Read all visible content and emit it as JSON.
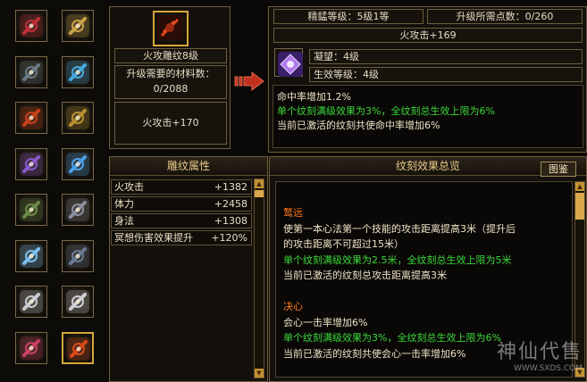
{
  "equipment": {
    "slots": [
      {
        "icon": "red-crystal-icon",
        "color": "#c0303a"
      },
      {
        "icon": "gold-ring-icon",
        "color": "#c8a24a"
      },
      {
        "icon": "armor-icon",
        "color": "#6a7a84"
      },
      {
        "icon": "blue-gem-ring-icon",
        "color": "#4aa8e0"
      },
      {
        "icon": "red-bracer-icon",
        "color": "#c8401a"
      },
      {
        "icon": "gold-bracer-icon",
        "color": "#b89030"
      },
      {
        "icon": "necklace-icon",
        "color": "#8a5ac8"
      },
      {
        "icon": "sword-icon",
        "color": "#4aa0e8"
      },
      {
        "icon": "belt-icon",
        "color": "#6a8a48"
      },
      {
        "icon": "gauntlet-icon",
        "color": "#8a90a0"
      },
      {
        "icon": "ice-blade-icon",
        "color": "#7ac0f0"
      },
      {
        "icon": "boots-icon",
        "color": "#6a7a94"
      },
      {
        "icon": "jade-pendant-icon",
        "color": "#c8ccd0"
      },
      {
        "icon": "jade-pendant-icon",
        "color": "#d0d0d4"
      },
      {
        "icon": "amulet-icon",
        "color": "#c84060"
      },
      {
        "icon": "red-talisman-icon",
        "color": "#d84a1a"
      }
    ],
    "selected_index": 15
  },
  "left_info": {
    "item_name": "火攻雕纹8级",
    "material_label": "升级需要的材料数：",
    "material_count": "0/2088",
    "next_attr": "火攻击+170"
  },
  "top_right": {
    "refine_level": "精錳等级：5级1等",
    "upgrade_points": "升级所需点数：0/260",
    "attack": "火攻击+169",
    "condense": "凝望：4级",
    "effect_level": "生效等级：4级",
    "desc": [
      {
        "text": "命中率增加1.2%",
        "color": "#eee2c6"
      },
      {
        "text": "单个纹刻满级效果为3%，全纹刻总生效上限为6%",
        "color": "#3ad83a"
      },
      {
        "text": "当前已激活的纹刻共使命中率增加6%",
        "color": "#eee2c6"
      }
    ]
  },
  "attributes": {
    "title": "雕纹属性",
    "rows": [
      {
        "name": "火攻击",
        "value": "+1382"
      },
      {
        "name": "体力",
        "value": "+2458"
      },
      {
        "name": "身法",
        "value": "+1308"
      },
      {
        "name": "冥想伤害效果提升",
        "value": "+120%"
      }
    ]
  },
  "effects": {
    "title": "纹刻效果总览",
    "button": "图鉴",
    "lines": [
      {
        "text": "鹜远",
        "color": "#ff7a1a"
      },
      {
        "text": "使第一本心法第一个技能的攻击距离提高3米（提升后",
        "color": "#eee2c6"
      },
      {
        "text": "的攻击距离不可超过15米）",
        "color": "#eee2c6"
      },
      {
        "text": "单个纹刻满级效果为2.5米，全纹刻总生效上限为5米",
        "color": "#3ad83a"
      },
      {
        "text": "当前已激活的纹刻总攻击距离提高3米",
        "color": "#eee2c6"
      },
      {
        "text": "",
        "color": "#eee2c6"
      },
      {
        "text": "决心",
        "color": "#ff7a1a"
      },
      {
        "text": "会心一击率增加6%",
        "color": "#eee2c6"
      },
      {
        "text": "单个纹刻满级效果为3%，全纹刻总生效上限为6%",
        "color": "#3ad83a"
      },
      {
        "text": "当前已激活的纹刻共使会心一击率增加6%",
        "color": "#eee2c6"
      }
    ]
  },
  "watermark": {
    "text": "神仙代售",
    "url": "WWW.SXDS.COM"
  }
}
